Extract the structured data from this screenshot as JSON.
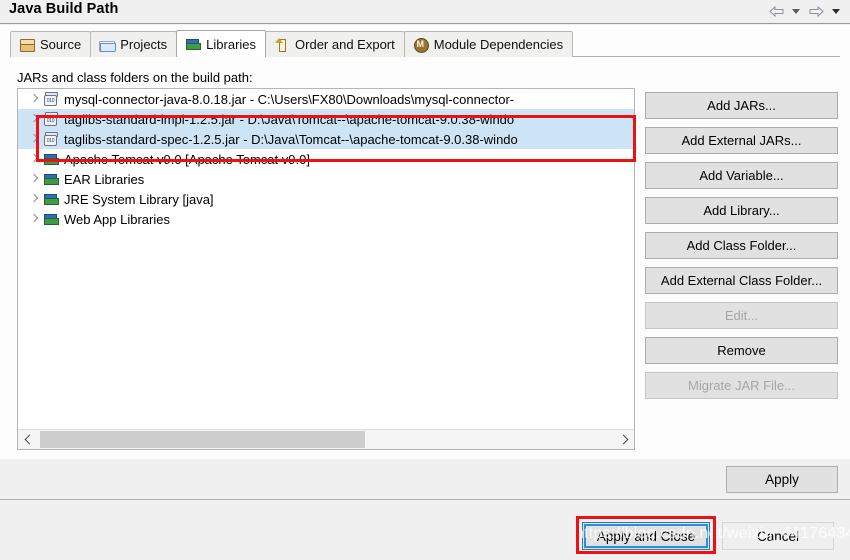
{
  "window": {
    "title": "Java Build Path",
    "nav": {
      "back_icon": "back-arrow-icon",
      "back_menu_icon": "chevron-down-icon",
      "forward_icon": "forward-arrow-icon",
      "forward_menu_icon": "chevron-down-icon"
    }
  },
  "tabs": [
    {
      "label": "Source",
      "icon": "package-icon",
      "active": false
    },
    {
      "label": "Projects",
      "icon": "folder-icon",
      "active": false
    },
    {
      "label": "Libraries",
      "icon": "books-icon",
      "active": true
    },
    {
      "label": "Order and Export",
      "icon": "up-arrow-icon",
      "active": false
    },
    {
      "label": "Module Dependencies",
      "icon": "module-icon",
      "active": false
    }
  ],
  "tree": {
    "caption": "JARs and class folders on the build path:",
    "rows": [
      {
        "text": "mysql-connector-java-8.0.18.jar - C:\\Users\\FX80\\Downloads\\mysql-connector-",
        "icon": "jar-icon",
        "selected": false
      },
      {
        "text": "taglibs-standard-impl-1.2.5.jar - D:\\Java\\Tomcat--\\apache-tomcat-9.0.38-windo",
        "icon": "jar-icon",
        "selected": true
      },
      {
        "text": "taglibs-standard-spec-1.2.5.jar - D:\\Java\\Tomcat--\\apache-tomcat-9.0.38-windo",
        "icon": "jar-icon",
        "selected": true
      },
      {
        "text": "Apache Tomcat v9.0 [Apache Tomcat v9.0]",
        "icon": "library-icon",
        "selected": false
      },
      {
        "text": "EAR Libraries",
        "icon": "library-icon",
        "selected": false
      },
      {
        "text": "JRE System Library [java]",
        "icon": "library-icon",
        "selected": false
      },
      {
        "text": "Web App Libraries",
        "icon": "library-icon",
        "selected": false
      }
    ],
    "scrollbar": {
      "left_arrow_icon": "chevron-left-icon",
      "right_arrow_icon": "chevron-right-icon"
    }
  },
  "side_buttons": [
    {
      "label": "Add JARs...",
      "enabled": true
    },
    {
      "label": "Add External JARs...",
      "enabled": true
    },
    {
      "label": "Add Variable...",
      "enabled": true
    },
    {
      "label": "Add Library...",
      "enabled": true
    },
    {
      "label": "Add Class Folder...",
      "enabled": true
    },
    {
      "label": "Add External Class Folder...",
      "enabled": true
    },
    {
      "label": "Edit...",
      "enabled": false
    },
    {
      "label": "Remove",
      "enabled": true
    },
    {
      "label": "Migrate JAR File...",
      "enabled": false
    }
  ],
  "footer": {
    "apply_label": "Apply",
    "apply_and_close_label": "Apply and Close",
    "cancel_label": "Cancel"
  },
  "watermark": "https://blog.csdn.net/weixin_44176434",
  "colors": {
    "selection": "#cde4f7",
    "annotation": "#ee1111",
    "focus_ring": "#2f8fd4",
    "button_face": "#e1e1e1",
    "dialog_background": "#f0f0f0"
  }
}
